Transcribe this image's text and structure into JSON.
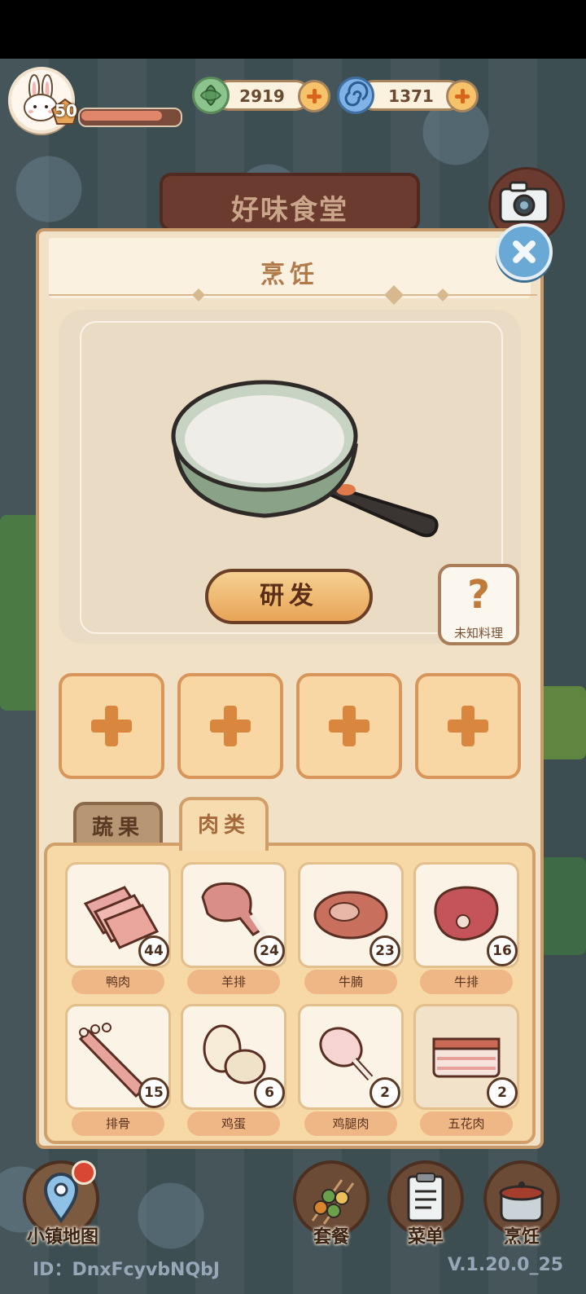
{
  "player": {
    "level": "50",
    "xp_fraction": 0.85
  },
  "currencies": [
    {
      "name": "leaf",
      "value": "2919"
    },
    {
      "name": "swirl",
      "value": "1371"
    }
  ],
  "restaurant_name": "好味食堂",
  "panel": {
    "title": "烹饪",
    "develop_label": "研发",
    "unknown_symbol": "?",
    "unknown_label": "未知料理"
  },
  "tabs": [
    {
      "label": "蔬果",
      "active": false
    },
    {
      "label": "肉类",
      "active": true
    }
  ],
  "ingredients": [
    {
      "name": "鸭肉",
      "count": "44",
      "icon": "duck-meat-icon"
    },
    {
      "name": "羊排",
      "count": "24",
      "icon": "lamb-chop-icon"
    },
    {
      "name": "牛腩",
      "count": "23",
      "icon": "beef-brisket-icon"
    },
    {
      "name": "牛排",
      "count": "16",
      "icon": "steak-icon"
    },
    {
      "name": "排骨",
      "count": "15",
      "icon": "ribs-icon"
    },
    {
      "name": "鸡蛋",
      "count": "6",
      "icon": "egg-icon"
    },
    {
      "name": "鸡腿肉",
      "count": "2",
      "icon": "drumstick-icon"
    },
    {
      "name": "五花肉",
      "count": "2",
      "icon": "pork-belly-icon"
    }
  ],
  "nav": {
    "map": "小镇地图",
    "set_meal": "套餐",
    "menu": "菜单",
    "cook": "烹饪"
  },
  "footer": {
    "id": "ID：DnxFcyvbNQbJ",
    "version": "V.1.20.0_25"
  },
  "colors": {
    "panel_bg": "#f1e1c6",
    "accent": "#e8a457",
    "scene_bg": "#3f5054"
  }
}
